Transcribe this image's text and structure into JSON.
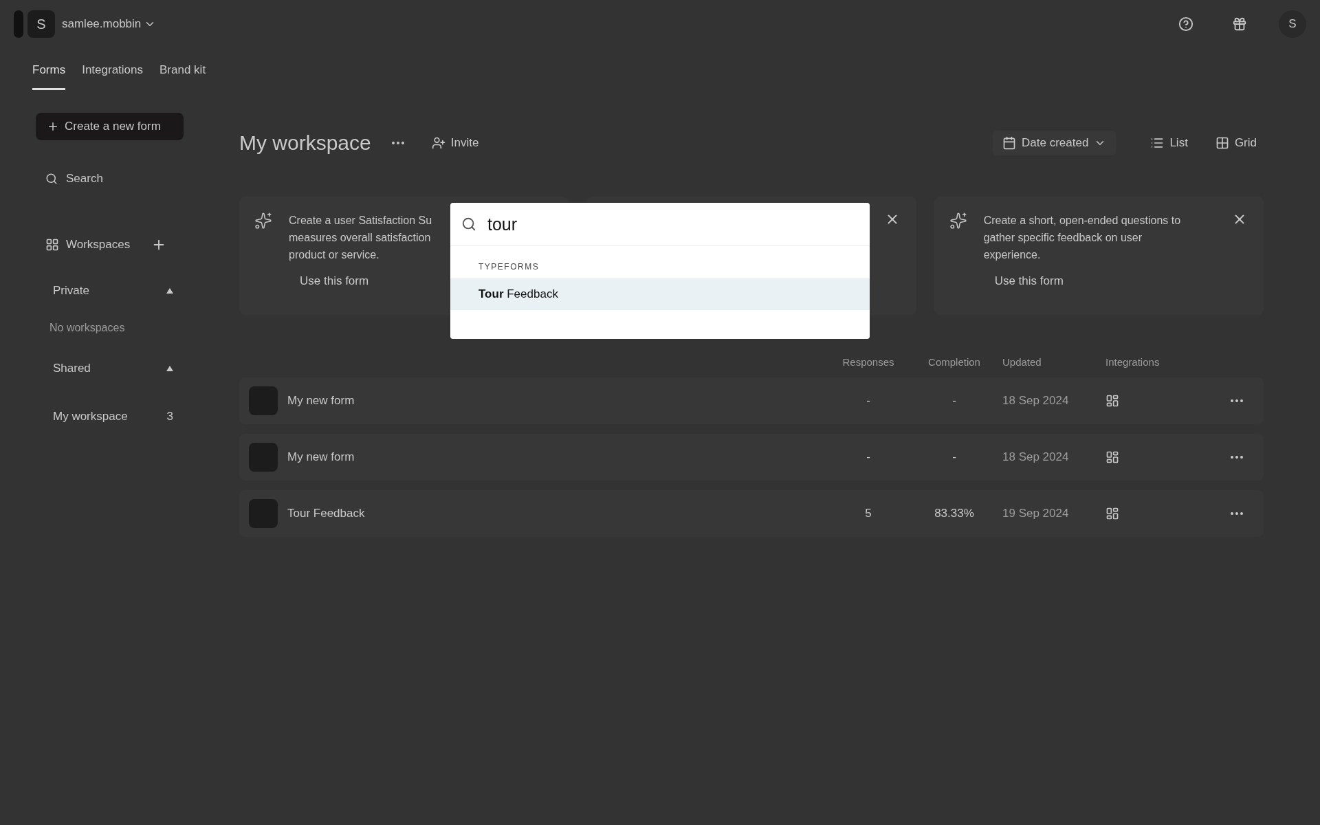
{
  "account": {
    "name": "samlee.mobbin",
    "logo_letter": "S"
  },
  "avatar": {
    "letter": "S"
  },
  "tabs": [
    {
      "label": "Forms",
      "selected": true
    },
    {
      "label": "Integrations",
      "selected": false
    },
    {
      "label": "Brand kit",
      "selected": false
    }
  ],
  "sidebar": {
    "create_button": "Create a new form",
    "search_placeholder": "Search",
    "workspaces_label": "Workspaces",
    "groups": [
      {
        "title": "Private",
        "expanded": true,
        "empty_text": "No workspaces"
      },
      {
        "title": "Shared",
        "expanded": true,
        "items": [
          {
            "name": "My workspace",
            "count": "3"
          }
        ]
      }
    ]
  },
  "header": {
    "title": "My workspace",
    "invite": "Invite",
    "sort": "Date created",
    "views": [
      "List",
      "Grid"
    ]
  },
  "suggestions": [
    {
      "kind": "suggestion",
      "lines": [
        "Create a user Satisfaction Su",
        "measures overall satisfaction",
        "product or service."
      ],
      "action": "Use this form"
    },
    {
      "kind": "covered"
    },
    {
      "kind": "suggestion",
      "lines": [
        "Create a short, open-ended questions to",
        "gather specific feedback on user",
        "experience."
      ],
      "action": "Use this form"
    }
  ],
  "table": {
    "columns": [
      "Responses",
      "Completion",
      "Updated",
      "Integrations"
    ],
    "rows": [
      {
        "name": "My new form",
        "responses": "-",
        "completion": "-",
        "updated": "18 Sep 2024"
      },
      {
        "name": "My new form",
        "responses": "-",
        "completion": "-",
        "updated": "18 Sep 2024"
      },
      {
        "name": "Tour Feedback",
        "responses": "5",
        "completion": "83.33%",
        "updated": "19 Sep 2024"
      }
    ]
  },
  "search_dialog": {
    "query": "tour",
    "section": "TYPEFORMS",
    "results": [
      {
        "label": "**Tour** Feedback",
        "selected": true
      }
    ]
  }
}
